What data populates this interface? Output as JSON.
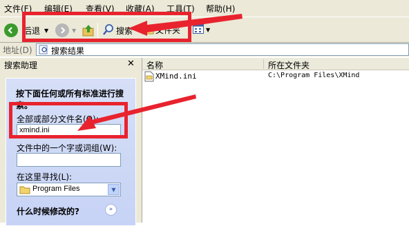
{
  "menu": [
    "文件(F)",
    "编辑(E)",
    "查看(V)",
    "收藏(A)",
    "工具(T)",
    "帮助(H)"
  ],
  "toolbar": {
    "back_label": "后退",
    "search_label": "搜索",
    "folders_label": "文件夹"
  },
  "address": {
    "label": "地址(D)",
    "value": "搜索结果"
  },
  "sidebar": {
    "title": "搜索助理",
    "heading": "按下面任何或所有标准进行搜索。",
    "filename_label": "全部或部分文件名(O):",
    "filename_value": "xmind.ini",
    "phrase_label": "文件中的一个字或词组(W):",
    "phrase_value": "",
    "lookin_label": "在这里寻找(L):",
    "lookin_value": "Program Files",
    "when_modified": "什么时候修改的?"
  },
  "list": {
    "columns": [
      "名称",
      "所在文件夹"
    ],
    "rows": [
      {
        "name": "XMind.ini",
        "folder": "C:\\Program Files\\XMind"
      }
    ]
  },
  "colors": {
    "annotation": "#e8232e",
    "window_bg": "#ece9d8",
    "panel_bg": "#d6dff7"
  }
}
